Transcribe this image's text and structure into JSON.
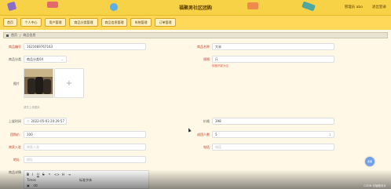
{
  "header": {
    "title": "福聚男社区团购",
    "user": "管理员 abo",
    "logout": "退出登录"
  },
  "nav": {
    "items": [
      "首页",
      "个人中心",
      "用户管理",
      "商品分类管理",
      "商品信息管理",
      "系统管理",
      "订单管理"
    ]
  },
  "breadcrumb": {
    "home": "首页",
    "current": "商品信息"
  },
  "form": {
    "product_code_label": "商品编号",
    "product_code_value": "1621669767163",
    "product_name_label": "商品名称",
    "product_name_value": "大米",
    "category_label": "商品分类",
    "category_value": "商品分类04",
    "spec_label": "规格",
    "spec_value": "斤",
    "spec_hint": "规格不能为空",
    "image_label": "图片",
    "image_hint": "请先上传图片",
    "time_label": "上架时间",
    "time_value": "2022-05-03 20:29:57",
    "stock_label": "价格",
    "stock_value": "398",
    "group_price_label": "团购价",
    "group_price_value": "100",
    "group_count_label": "成团人数",
    "group_count_value": "5",
    "producer_label": "商家入驻",
    "producer_placeholder": "商家入驻",
    "phone_label": "电话",
    "phone_placeholder": "电话",
    "address_label": "地址",
    "address_placeholder": "地址",
    "detail_label": "商品详情"
  },
  "editor": {
    "font_label": "Times",
    "size_label": "标准字体"
  },
  "watermark": "CSDN @编程设计",
  "fab_label": "客服"
}
